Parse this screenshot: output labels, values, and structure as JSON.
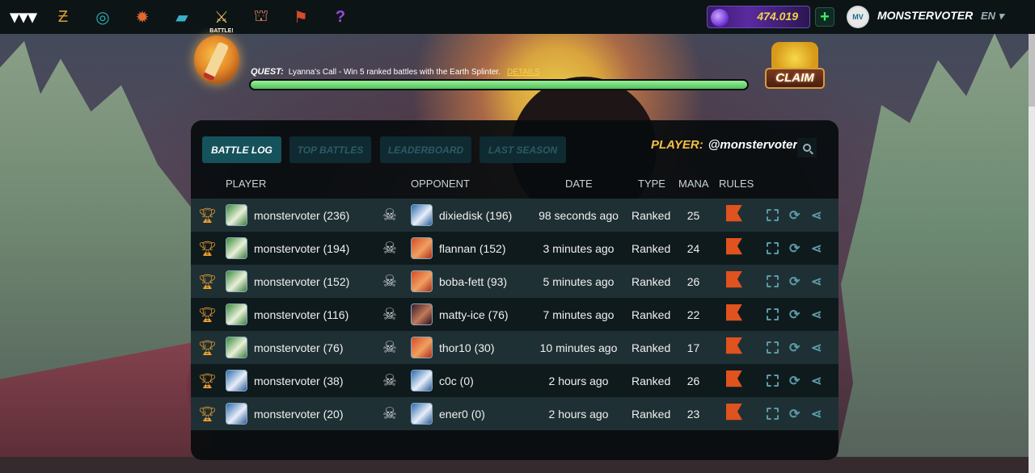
{
  "topbar": {
    "nav": [
      {
        "name": "logo-icon",
        "glyph": "▾▾▾"
      },
      {
        "name": "tokens-icon",
        "glyph": "Ƶ"
      },
      {
        "name": "portal-icon",
        "glyph": "◎"
      },
      {
        "name": "splinter-icon",
        "glyph": "✹"
      },
      {
        "name": "cards-icon",
        "glyph": "▰"
      },
      {
        "name": "battle-icon",
        "glyph": "⚔"
      },
      {
        "name": "shop-icon",
        "glyph": "⛫"
      },
      {
        "name": "guild-icon",
        "glyph": "⚑"
      },
      {
        "name": "help-icon",
        "glyph": "?"
      }
    ],
    "battle_badge": "BATTLE!",
    "dec_balance": "474.019",
    "add_label": "+",
    "avatar_initials": "MV",
    "username": "MONSTERVOTER",
    "language": "EN ▾"
  },
  "quest": {
    "label": "QUEST:",
    "text": "Lyanna's Call - Win 5 ranked battles with the Earth Splinter.",
    "details_link": "DETAILS",
    "progress": 1.0,
    "claim_label": "CLAIM"
  },
  "panel": {
    "tabs": [
      {
        "label": "BATTLE LOG",
        "active": true
      },
      {
        "label": "TOP BATTLES",
        "active": false
      },
      {
        "label": "LEADERBOARD",
        "active": false
      },
      {
        "label": "LAST SEASON",
        "active": false
      }
    ],
    "player_filter_label": "PLAYER:",
    "player_filter_value": "@monstervoter",
    "columns": {
      "player": "PLAYER",
      "opponent": "OPPONENT",
      "date": "DATE",
      "type": "TYPE",
      "mana": "MANA",
      "rules": "RULES"
    },
    "rows": [
      {
        "player": "monstervoter (236)",
        "player_splinter": "earth",
        "opponent": "dixiedisk (196)",
        "opponent_splinter": "water",
        "date": "98 seconds ago",
        "type": "Ranked",
        "mana": "25"
      },
      {
        "player": "monstervoter (194)",
        "player_splinter": "earth",
        "opponent": "flannan (152)",
        "opponent_splinter": "fire",
        "date": "3 minutes ago",
        "type": "Ranked",
        "mana": "24"
      },
      {
        "player": "monstervoter (152)",
        "player_splinter": "earth",
        "opponent": "boba-fett (93)",
        "opponent_splinter": "fire",
        "date": "5 minutes ago",
        "type": "Ranked",
        "mana": "26"
      },
      {
        "player": "monstervoter (116)",
        "player_splinter": "earth",
        "opponent": "matty-ice (76)",
        "opponent_splinter": "death",
        "date": "7 minutes ago",
        "type": "Ranked",
        "mana": "22"
      },
      {
        "player": "monstervoter (76)",
        "player_splinter": "earth",
        "opponent": "thor10 (30)",
        "opponent_splinter": "fire",
        "date": "10 minutes ago",
        "type": "Ranked",
        "mana": "17"
      },
      {
        "player": "monstervoter (38)",
        "player_splinter": "water",
        "opponent": "c0c (0)",
        "opponent_splinter": "water",
        "date": "2 hours ago",
        "type": "Ranked",
        "mana": "26"
      },
      {
        "player": "monstervoter (20)",
        "player_splinter": "water",
        "opponent": "ener0 (0)",
        "opponent_splinter": "water",
        "date": "2 hours ago",
        "type": "Ranked",
        "mana": "23"
      }
    ]
  }
}
